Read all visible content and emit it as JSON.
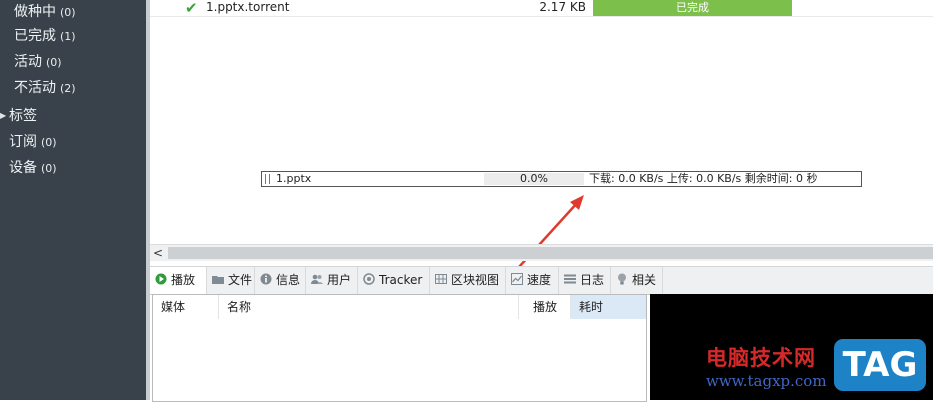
{
  "sidebar": {
    "items": [
      {
        "label": "做种中",
        "count": "(0)"
      },
      {
        "label": "已完成",
        "count": "(1)"
      },
      {
        "label": "活动",
        "count": "(0)"
      },
      {
        "label": "不活动",
        "count": "(2)"
      },
      {
        "label": "标签",
        "count": ""
      },
      {
        "label": "订阅",
        "count": "(0)"
      },
      {
        "label": "设备",
        "count": "(0)"
      }
    ]
  },
  "torrent": {
    "name": "1.pptx.torrent",
    "size": "2.17 KB",
    "status": "已完成"
  },
  "floatbar": {
    "name": "1.pptx",
    "progress": "0.0%",
    "progress_value": 0.0,
    "stats": "下载: 0.0 KB/s  上传: 0.0 KB/s  剩余时间: 0 秒"
  },
  "scroll": {
    "left_arrow": "<"
  },
  "tabs": [
    {
      "label": "播放",
      "icon": "play-icon"
    },
    {
      "label": "文件",
      "icon": "folder-icon"
    },
    {
      "label": "信息",
      "icon": "info-icon"
    },
    {
      "label": "用户",
      "icon": "users-icon"
    },
    {
      "label": "Tracker",
      "icon": "tracker-icon"
    },
    {
      "label": "区块视图",
      "icon": "grid-icon"
    },
    {
      "label": "速度",
      "icon": "chart-icon"
    },
    {
      "label": "日志",
      "icon": "log-icon"
    },
    {
      "label": "相关",
      "icon": "bulb-icon"
    }
  ],
  "columns": [
    "媒体",
    "名称",
    "播放",
    "耗时"
  ],
  "watermark": {
    "cn": "电脑技术网",
    "url": "www.tagxp.com",
    "badge": "TAG"
  },
  "colors": {
    "sidebar": "#39424a",
    "status_done": "#7dbf4b",
    "accent_arrow": "#e03a2e",
    "badge": "#1e82c6"
  }
}
